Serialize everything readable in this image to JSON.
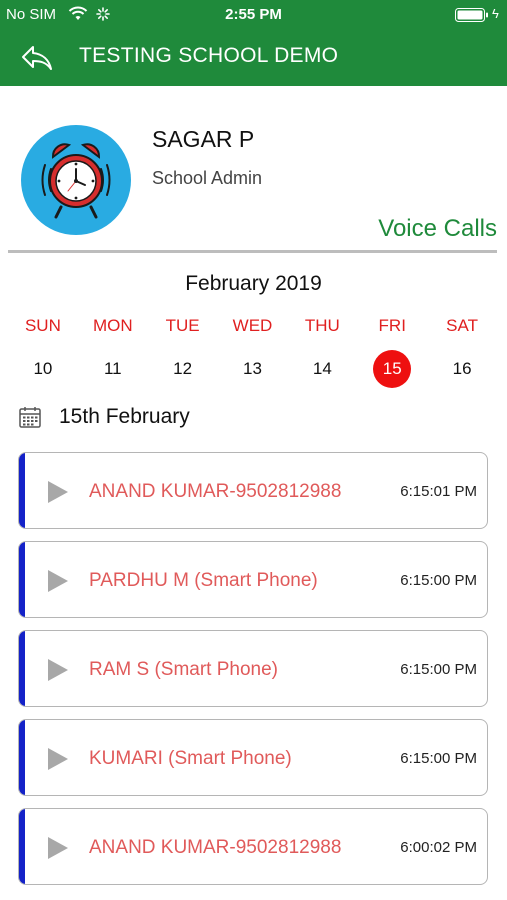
{
  "status_bar": {
    "carrier": "No SIM",
    "time": "2:55 PM",
    "icons": [
      "wifi-icon",
      "spinner-icon",
      "battery-icon",
      "charging-icon"
    ]
  },
  "app_bar": {
    "back_icon": "back-arrow-icon",
    "title": "TESTING SCHOOL DEMO"
  },
  "profile": {
    "avatar_icon": "alarm-clock-icon",
    "name": "SAGAR P",
    "role": "School Admin"
  },
  "section_title": "Voice Calls",
  "calendar": {
    "month": "February 2019",
    "weekdays": [
      "SUN",
      "MON",
      "TUE",
      "WED",
      "THU",
      "FRI",
      "SAT"
    ],
    "dates": [
      "10",
      "11",
      "12",
      "13",
      "14",
      "15",
      "16"
    ],
    "selected_index": 5
  },
  "day_header": {
    "icon": "calendar-icon",
    "label": "15th February"
  },
  "calls": [
    {
      "caller": "ANAND KUMAR-9502812988",
      "time": "6:15:01 PM"
    },
    {
      "caller": "PARDHU M (Smart Phone)",
      "time": "6:15:00 PM"
    },
    {
      "caller": "RAM S (Smart Phone)",
      "time": "6:15:00 PM"
    },
    {
      "caller": "KUMARI  (Smart Phone)",
      "time": "6:15:00 PM"
    },
    {
      "caller": "ANAND KUMAR-9502812988",
      "time": "6:00:02 PM"
    }
  ],
  "colors": {
    "brand_green": "#1f8a3b",
    "selected_red": "#ee1010",
    "weekday_red": "#e02020",
    "caller_red": "#e05a5a",
    "accent_blue": "#1422c8"
  }
}
